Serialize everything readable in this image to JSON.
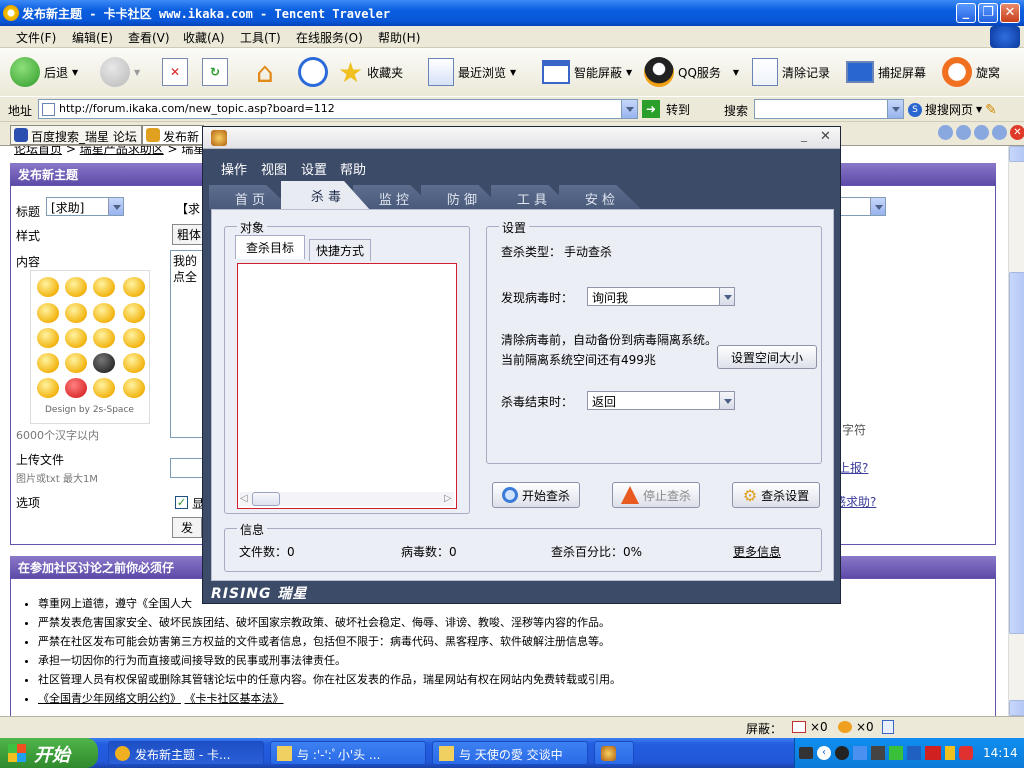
{
  "window": {
    "title": "发布新主题 - 卡卡社区 www.ikaka.com - Tencent Traveler"
  },
  "menubar": [
    "文件(F)",
    "编辑(E)",
    "查看(V)",
    "收藏(A)",
    "工具(T)",
    "在线服务(O)",
    "帮助(H)"
  ],
  "toolbar": {
    "back": "后退",
    "favorites": "收藏夹",
    "recent": "最近浏览",
    "smart_block": "智能屏蔽",
    "qq_service": "QQ服务",
    "clear_history": "清除记录",
    "capture": "捕捉屏幕",
    "rotate": "旋窝"
  },
  "address": {
    "label": "地址",
    "url": "http://forum.ikaka.com/new_topic.asp?board=112",
    "go": "转到",
    "search_label": "搜索",
    "search_value": "",
    "search_engine": "搜搜网页"
  },
  "tabs": [
    "百度搜索_瑞星 论坛",
    "发布新"
  ],
  "page": {
    "breadcrumb_a": "论坛首页",
    "breadcrumb_b": "瑞星产品求助区",
    "breadcrumb_c": "瑞星",
    "header1": "发布新主题",
    "title_label": "标题",
    "title_select": "[求助]",
    "title_bracket": "【求",
    "style_label": "样式",
    "style_bold": "粗体",
    "content_label": "内容",
    "content_text_a": "我的",
    "content_text_b": "点全",
    "design_by": "Design by 2s-Space",
    "limit_text": "6000个汉字以内",
    "upload_label": "上传文件",
    "upload_hint": "图片或txt 最大1M",
    "options_label": "选项",
    "options_check": "显",
    "submit": "发",
    "right_1": "字符",
    "right_2": "上报?",
    "right_3": "感求助?",
    "header2": "在参加社区讨论之前你必须仔",
    "rules": [
      "尊重网上道德，遵守《全国人大",
      "严禁发表危害国家安全、破坏民族团结、破坏国家宗教政策、破坏社会稳定、侮辱、诽谤、教唆、淫秽等内容的作品。",
      "严禁在社区发布可能会妨害第三方权益的文件或者信息，包括但不限于：病毒代码、黑客程序、软件破解注册信息等。",
      "承担一切因你的行为而直接或间接导致的民事或刑事法律责任。",
      "社区管理人员有权保留或删除其管辖论坛中的任意内容。你在社区发表的作品，瑞星网站有权在网站内免费转载或引用。"
    ],
    "rule_links": [
      "《全国青少年网络文明公约》",
      "《卡卡社区基本法》"
    ]
  },
  "status": {
    "block_label": "屏蔽：",
    "count1": "×0",
    "count2": "×0"
  },
  "taskbar": {
    "start": "开始",
    "tasks": [
      "发布新主题 - 卡...",
      "与 :'-':ﾟ小'头 ...",
      "与 天使の愛 交谈中"
    ],
    "clock": "14:14"
  },
  "dialog": {
    "menu": [
      "操作",
      "视图",
      "设置",
      "帮助"
    ],
    "tabs": [
      "首 页",
      "杀 毒",
      "监 控",
      "防 御",
      "工 具",
      "安 检"
    ],
    "target_group": "对象",
    "subtab_a": "查杀目标",
    "subtab_b": "快捷方式",
    "settings_group": "设置",
    "scan_type_label": "查杀类型：",
    "scan_type_value": "手动查杀",
    "virus_found_label": "发现病毒时：",
    "virus_found_value": "询问我",
    "backup_note": "清除病毒前，自动备份到病毒隔离系统。",
    "quarantine_note": "当前隔离系统空间还有499兆",
    "set_space_btn": "设置空间大小",
    "finish_label": "杀毒结束时：",
    "finish_value": "返回",
    "start_btn": "开始查杀",
    "stop_btn": "停止查杀",
    "settings_btn": "查杀设置",
    "info_group": "信息",
    "files_label": "文件数：0",
    "virus_label": "病毒数：0",
    "percent_label": "查杀百分比：0%",
    "more_info": "更多信息",
    "brand": "RISING 瑞星"
  }
}
